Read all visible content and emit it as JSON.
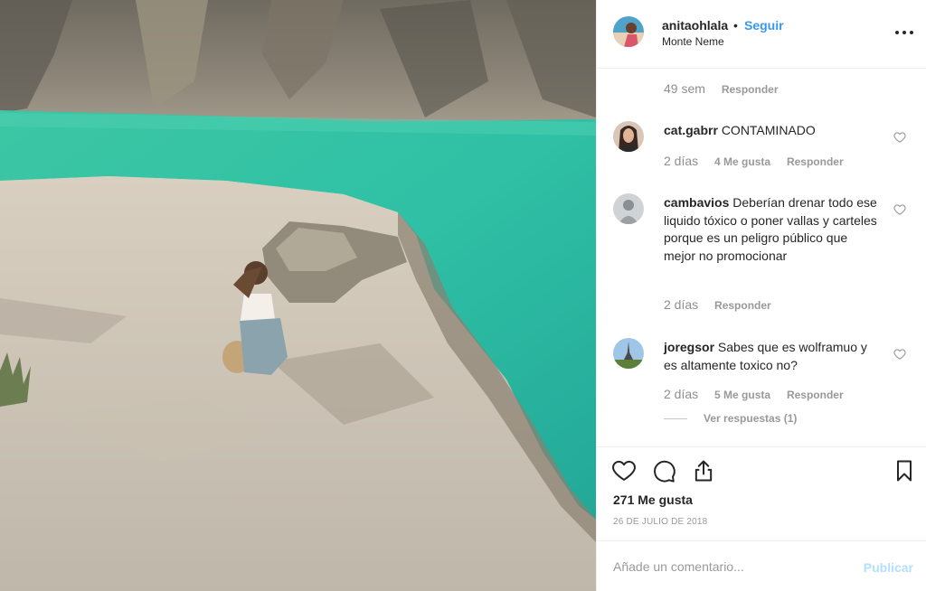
{
  "post": {
    "username": "anitaohlala",
    "separator": "•",
    "follow_label": "Seguir",
    "location": "Monte Neme",
    "likes": "271 Me gusta",
    "date": "26 DE JULIO DE 2018"
  },
  "comments": {
    "top_meta": {
      "time": "49 sem",
      "reply": "Responder"
    },
    "items": [
      {
        "user": "cat.gabrr",
        "text": "CONTAMINADO",
        "time": "2 días",
        "likes": "4 Me gusta",
        "reply": "Responder"
      },
      {
        "user": "cambavios",
        "text": "Deberían drenar todo ese liquido tóxico o poner vallas y carteles porque es un peligro público que mejor no promocionar",
        "time": "2 días",
        "reply": "Responder"
      },
      {
        "user": "joregsor",
        "text": "Sabes que es wolframuo y es altamente toxico no?",
        "time": "2 días",
        "likes": "5 Me gusta",
        "reply": "Responder",
        "view_replies": "Ver respuestas (1)"
      }
    ]
  },
  "composer": {
    "placeholder": "Añade un comentario...",
    "publish_label": "Publicar"
  },
  "icons": {
    "like": "heart-icon",
    "comment": "comment-icon",
    "share": "share-icon",
    "save": "bookmark-icon",
    "more": "more-options-icon"
  },
  "colors": {
    "link_blue": "#3897f0",
    "publish_disabled": "#b2dffc",
    "secondary_text": "#999999",
    "border": "#efefef"
  }
}
